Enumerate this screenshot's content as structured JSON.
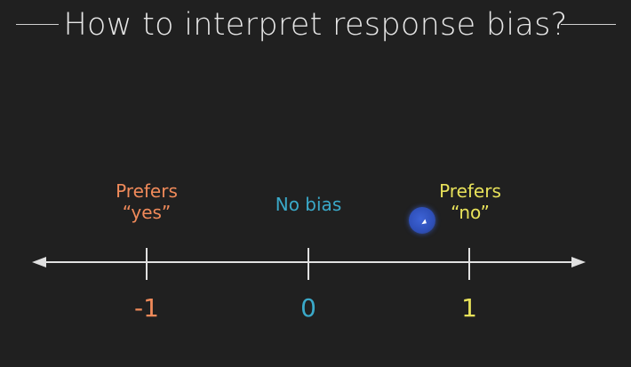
{
  "title": "How to interpret response bias?",
  "scale": {
    "points": [
      {
        "value": "-1",
        "label_lines": [
          "Prefers",
          "“yes”"
        ],
        "color": "#f08a5a"
      },
      {
        "value": "0",
        "label_lines": [
          "No bias"
        ],
        "color": "#3aa9c9"
      },
      {
        "value": "1",
        "label_lines": [
          "Prefers",
          "“no”"
        ],
        "color": "#e8e25a"
      }
    ]
  },
  "colors": {
    "background": "#202020",
    "axis": "#e0e0e0",
    "title": "#e6e6e6"
  }
}
